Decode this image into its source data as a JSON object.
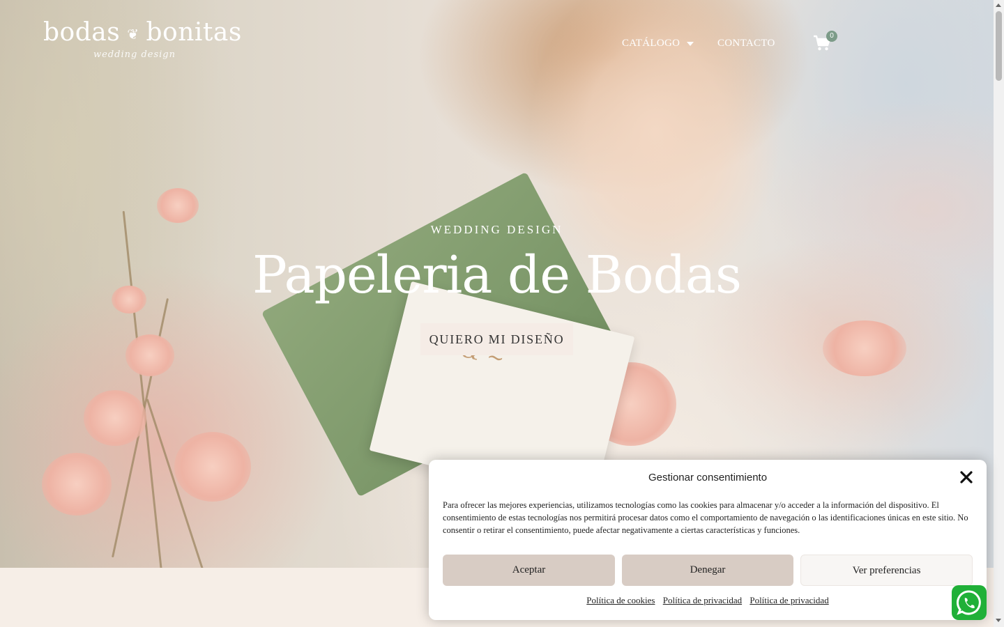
{
  "brand": {
    "name_part1": "bodas",
    "name_part2": "bonitas",
    "tagline": "wedding design"
  },
  "nav": {
    "catalog": "CATÁLOGO",
    "contact": "CONTACTO",
    "cart_count": "0"
  },
  "hero": {
    "eyebrow": "WEDDING DESIGN",
    "headline": "Papeleria de Bodas",
    "cta": "QUIERO MI DISEÑO"
  },
  "consent": {
    "title": "Gestionar consentimiento",
    "body": "Para ofrecer las mejores experiencias, utilizamos tecnologías como las cookies para almacenar y/o acceder a la información del dispositivo. El consentimiento de estas tecnologías nos permitirá procesar datos como el comportamiento de navegación o las identificaciones únicas en este sitio. No consentir o retirar el consentimiento, puede afectar negativamente a ciertas características y funciones.",
    "accept": "Aceptar",
    "deny": "Denegar",
    "preferences": "Ver preferencias",
    "links": [
      "Política de cookies",
      "Política de privacidad",
      "Política de privacidad"
    ]
  },
  "colors": {
    "accent_badge": "#7c9b88",
    "button_bg": "#d8ccc4",
    "whatsapp": "#20b038",
    "page_bg": "#f6eee7"
  },
  "icons": [
    "cart-icon",
    "chevron-down-icon",
    "close-icon",
    "whatsapp-icon"
  ]
}
